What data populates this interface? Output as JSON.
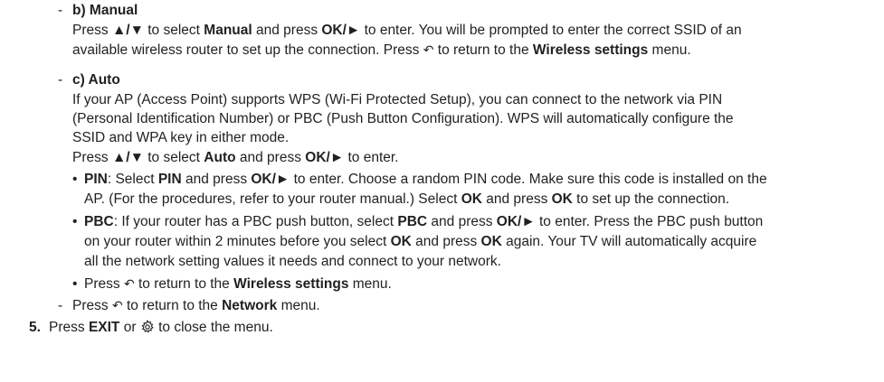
{
  "manual": {
    "heading": "b) Manual",
    "l1": [
      "Press ",
      "▲/▼",
      " to select ",
      "Manual",
      " and press ",
      "OK/►",
      " to enter. You will be prompted to enter the correct SSID of an"
    ],
    "l2": [
      "available wireless router to set up the connection. Press ",
      "↶",
      " to return to the ",
      "Wireless settings",
      " menu."
    ]
  },
  "auto": {
    "heading": "c) Auto",
    "p1": "If your AP (Access Point) supports WPS (Wi-Fi Protected Setup), you can connect to the network via PIN",
    "p2": "(Personal Identification Number) or PBC (Push Button Configuration). WPS will automatically configure the",
    "p3": "SSID and WPA key in either mode.",
    "l4": [
      "Press ",
      "▲/▼",
      " to select ",
      "Auto",
      " and press ",
      "OK/►",
      " to enter."
    ],
    "pin": {
      "l1": [
        "PIN",
        ": Select ",
        "PIN",
        " and press ",
        "OK/►",
        " to enter. Choose a random PIN code. Make sure this code is installed on the"
      ],
      "l2": [
        "AP. (For the procedures, refer to your router manual.) Select ",
        "OK",
        " and press ",
        "OK",
        " to set up the connection."
      ]
    },
    "pbc": {
      "l1": [
        "PBC",
        ": If your router has a PBC push button, select ",
        "PBC",
        " and press ",
        "OK/►",
        " to enter. Press the PBC push button"
      ],
      "l2": [
        "on your router within 2 minutes before you select ",
        "OK",
        " and press ",
        "OK",
        " again. Your TV will automatically acquire"
      ],
      "l3": "all the network setting values it needs and connect to your network."
    },
    "ret": [
      "Press ",
      "↶",
      " to return to the ",
      "Wireless settings",
      " menu."
    ]
  },
  "network_return": [
    "Press ",
    "↶",
    " to return to the ",
    "Network",
    " menu."
  ],
  "step5": {
    "num": "5.",
    "parts": [
      "Press ",
      "EXIT",
      " or ",
      " to close the menu."
    ],
    "icon": "settings-gear-icon"
  },
  "markers": {
    "dash": "-",
    "bullet": "•"
  }
}
